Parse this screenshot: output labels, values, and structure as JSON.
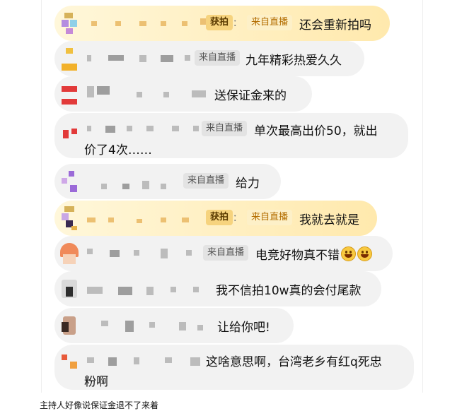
{
  "tags": {
    "source": "来自直播",
    "bid": "获拍",
    "separator": "："
  },
  "comments": [
    {
      "id": 1,
      "text": "还会重新拍吗",
      "highlighted": true
    },
    {
      "id": 2,
      "text": "九年精彩热爱久久"
    },
    {
      "id": 3,
      "text": "送保证金来的"
    },
    {
      "id": 4,
      "text_line1": "单次最高出价50，就出",
      "text_line2": "价了4次……"
    },
    {
      "id": 5,
      "text": "给力"
    },
    {
      "id": 6,
      "text": "我就去就是",
      "highlighted": true
    },
    {
      "id": 7,
      "text": "电竞好物真不错"
    },
    {
      "id": 8,
      "text": "我不信拍10w真的会付尾款"
    },
    {
      "id": 9,
      "text": "让给你吧!"
    },
    {
      "id": 10,
      "text_line1": "这啥意思啊，台湾老乡有红q死忠",
      "text_line2": "粉啊"
    }
  ],
  "caption": "主持人好像说保证金退不了来着",
  "colors": {
    "bubble": "#f2f2f2",
    "highlight_bubble": "#ffe9ad",
    "source_tag_text": "#b36d00",
    "heart": "#ffc6cf"
  },
  "icons": {
    "reaction": "heart-icon",
    "emoji": "grinning-face-emoji"
  }
}
